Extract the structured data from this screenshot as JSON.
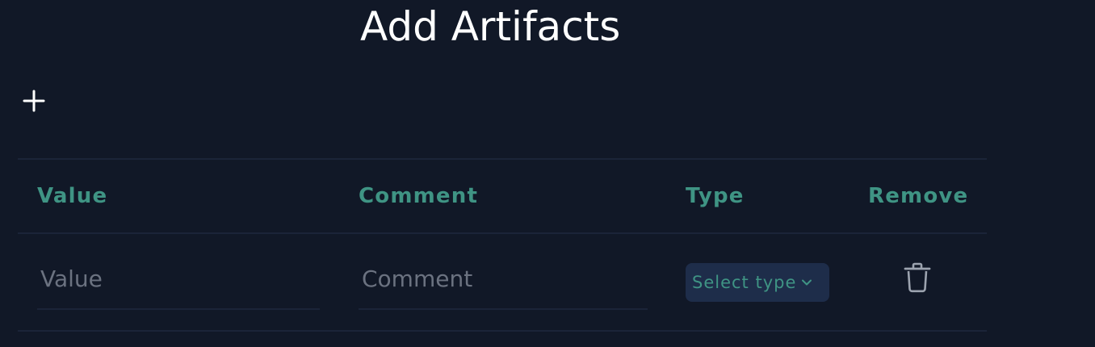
{
  "page": {
    "title": "Add Artifacts"
  },
  "toolbar": {
    "add_icon": "plus-icon"
  },
  "table": {
    "headers": [
      "Value",
      "Comment",
      "Type",
      "Remove"
    ],
    "rows": [
      {
        "value_placeholder": "Value",
        "comment_placeholder": "Comment",
        "type_label": "Select type",
        "type_icon": "chevron-down-icon",
        "remove_icon": "trash-icon"
      }
    ]
  },
  "colors": {
    "background": "#111827",
    "accent": "#3f9484",
    "divider": "#1b2438",
    "select_background": "#1e2d4a",
    "placeholder": "#6b7280",
    "icon_muted": "#9ca3af"
  }
}
